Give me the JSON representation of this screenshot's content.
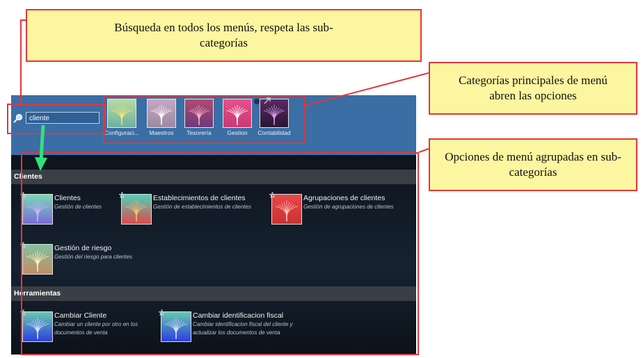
{
  "search": {
    "value": "cliente"
  },
  "categories": [
    {
      "label": "Configuraci...",
      "gradient": [
        "#b8dc9e",
        "#6fb0a0"
      ],
      "tree": "#f4e87a"
    },
    {
      "label": "Maestros",
      "gradient": [
        "#c7a7c1",
        "#9c8aa0"
      ],
      "tree": "#ffffff"
    },
    {
      "label": "Tesorería",
      "gradient": [
        "#b14a72",
        "#6c3a7a"
      ],
      "tree": "#f3b2c8"
    },
    {
      "label": "Gestion",
      "gradient": [
        "#e8508a",
        "#c83a74"
      ],
      "tree": "#ffffff"
    },
    {
      "label": "Contabilidad",
      "gradient": [
        "#5a2a62",
        "#2a1533"
      ],
      "tree": "#d9a0ef"
    }
  ],
  "sections": [
    {
      "title": "Clientes",
      "items": [
        {
          "title": "Clientes",
          "desc": "Gestión de clientes",
          "gradient": [
            "#79d8b6",
            "#7a6ad8"
          ],
          "tree": "#c9b8ff"
        },
        {
          "title": "Establecimientos de clientes",
          "desc": "Gestión de establecimientos de clientes",
          "gradient": [
            "#4fd0b9",
            "#e04949"
          ],
          "tree": "#f4c278"
        },
        {
          "title": "Agrupaciones de clientes",
          "desc": "Gestión de agrupaciones de clientes",
          "gradient": [
            "#e84747",
            "#c93232"
          ],
          "tree": "#ffc6c6"
        },
        {
          "title": "Gestión de riesgo",
          "desc": "Gestión del riesgo para clientes",
          "gradient": [
            "#7ec39f",
            "#c68c62"
          ],
          "tree": "#fff0c4"
        }
      ]
    },
    {
      "title": "Herramientas",
      "items": [
        {
          "title": "Cambiar Cliente",
          "desc": "Cambiar un cliente por otro en los documentos de venta",
          "gradient": [
            "#67c8b0",
            "#2b3ee0"
          ],
          "tree": "#d9e4ff"
        },
        {
          "title": "Cambiar identificacion fiscal",
          "desc": "Cambiar identificacion fiscal del cliente y actualizar los documentos de venta",
          "gradient": [
            "#67c8b0",
            "#2b3ee0"
          ],
          "tree": "#d9e4ff"
        }
      ]
    }
  ],
  "annotations": {
    "search_note": "Búsqueda en todos los menús, respeta las sub-categorías",
    "categories_note": "Categorías principales de menú abren las opciones",
    "options_note": "Opciones de menú agrupadas en sub-categorías",
    "border_color": "#e2363b",
    "note_bg": "#fcf6a0",
    "arrow_color": "#33e07a"
  }
}
